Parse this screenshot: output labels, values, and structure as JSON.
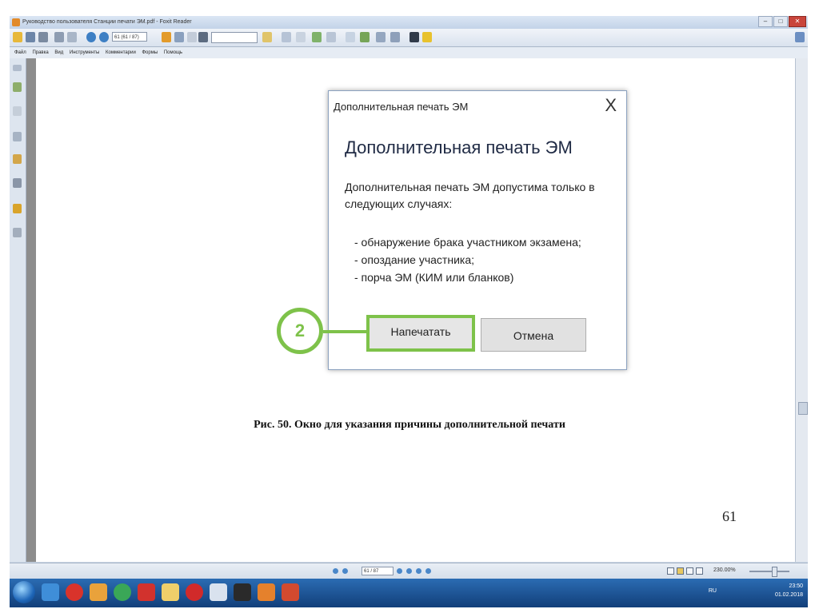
{
  "window": {
    "title": "Руководство пользователя Станции печати ЭМ.pdf - Foxit Reader",
    "controls": {
      "minimize": "–",
      "maximize": "□",
      "close": "✕"
    }
  },
  "toolbar": {
    "page_field": "61 (61 / 87)",
    "search_placeholder": ""
  },
  "menu": {
    "items": [
      "Файл",
      "Правка",
      "Вид",
      "Инструменты",
      "Комментарии",
      "Формы",
      "Помощь"
    ]
  },
  "dialog": {
    "title": "Дополнительная печать ЭМ",
    "close_icon": "X",
    "heading": "Дополнительная печать ЭМ",
    "text": "Дополнительная печать ЭМ допустима только в\nследующих случаях:",
    "list": [
      "- обнаружение брака участником экзамена;",
      "- опоздание участника;",
      "- порча ЭМ (КИМ или бланков)"
    ],
    "print_button": "Напечатать",
    "cancel_button": "Отмена"
  },
  "callout": {
    "number": "2",
    "color": "#7ec24a"
  },
  "document": {
    "caption": "Рис. 50. Окно для указания причины дополнительной печати",
    "page_number": "61"
  },
  "statusbar": {
    "page_field": "61 / 87",
    "zoom": "230.00%"
  },
  "taskbar": {
    "language": "RU",
    "time": "23:50",
    "date": "01.02.2018"
  },
  "colors": {
    "accent_green": "#7ec24a",
    "taskbar_blue": "#1f5a9e"
  }
}
